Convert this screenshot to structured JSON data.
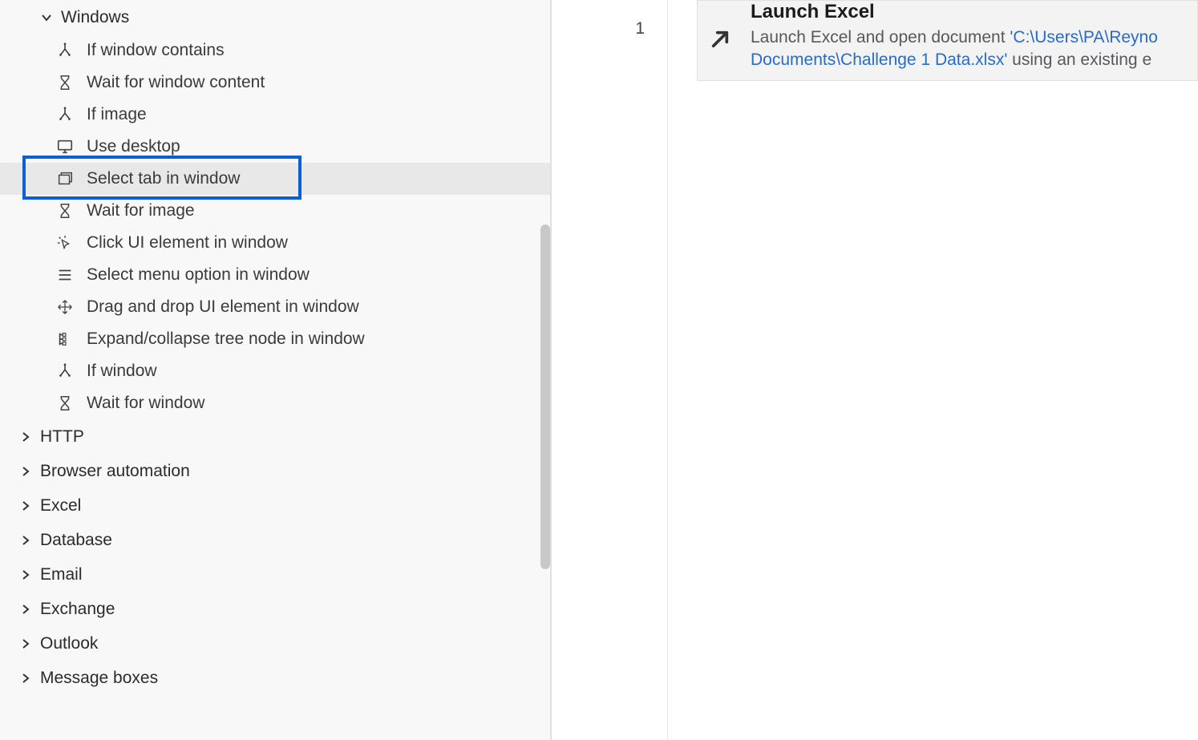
{
  "sidebar": {
    "expanded_category": "Windows",
    "actions": [
      {
        "label": "If window contains",
        "icon": "branch"
      },
      {
        "label": "Wait for window content",
        "icon": "hourglass"
      },
      {
        "label": "If image",
        "icon": "branch"
      },
      {
        "label": "Use desktop",
        "icon": "monitor"
      },
      {
        "label": "Select tab in window",
        "icon": "tabs",
        "hover": true,
        "highlighted": true
      },
      {
        "label": "Wait for image",
        "icon": "hourglass"
      },
      {
        "label": "Click UI element in window",
        "icon": "click"
      },
      {
        "label": "Select menu option in window",
        "icon": "menu"
      },
      {
        "label": "Drag and drop UI element in window",
        "icon": "drag"
      },
      {
        "label": "Expand/collapse tree node in window",
        "icon": "tree"
      },
      {
        "label": "If window",
        "icon": "branch"
      },
      {
        "label": "Wait for window",
        "icon": "hourglass"
      }
    ],
    "collapsed_categories": [
      "HTTP",
      "Browser automation",
      "Excel",
      "Database",
      "Email",
      "Exchange",
      "Outlook",
      "Message boxes"
    ]
  },
  "flow": {
    "line_number": "1",
    "step": {
      "title": "Launch Excel",
      "prefix": "Launch Excel and open document ",
      "path": "'C:\\Users\\PA\\Reyno Documents\\Challenge 1 Data.xlsx'",
      "suffix": " using an existing e"
    }
  }
}
